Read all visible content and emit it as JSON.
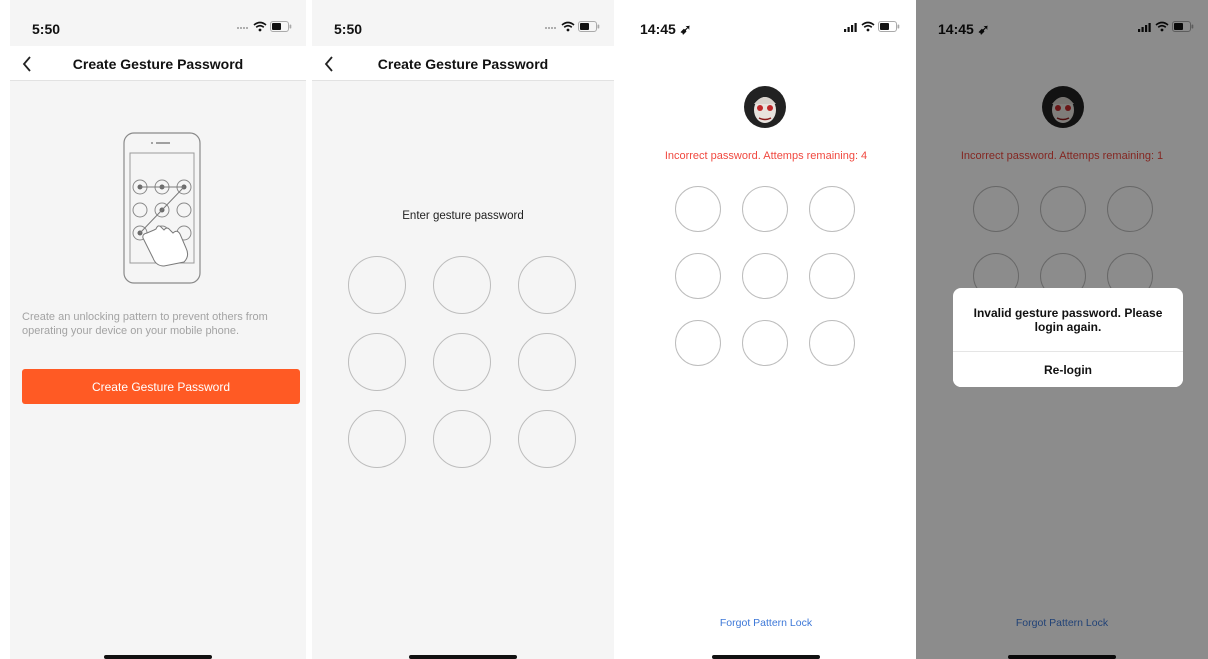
{
  "colors": {
    "accent": "#ff5a24",
    "error": "#f0483f",
    "link": "#3d78d8",
    "overlay": "rgba(0,0,0,0.45)"
  },
  "screens": [
    {
      "time": "5:50",
      "title": "Create Gesture Password",
      "description": "Create an unlocking pattern to prevent others from operating your device on your mobile phone.",
      "button_label": "Create Gesture Password"
    },
    {
      "time": "5:50",
      "title": "Create Gesture Password",
      "prompt": "Enter gesture password"
    },
    {
      "time": "14:45",
      "error": "Incorrect password. Attemps remaining: 4",
      "forgot_label": "Forgot Pattern Lock"
    },
    {
      "time": "14:45",
      "error": "Incorrect password. Attemps remaining: 1",
      "forgot_label": "Forgot Pattern Lock",
      "dialog": {
        "message": "Invalid gesture password. Please login again.",
        "button": "Re-login"
      }
    }
  ]
}
